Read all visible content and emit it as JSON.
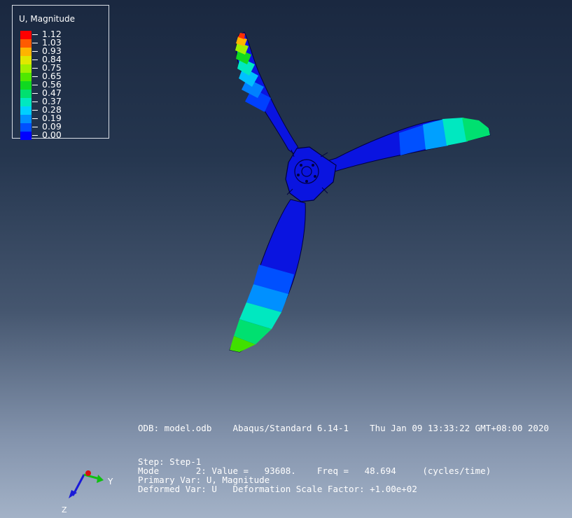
{
  "legend": {
    "title": "U, Magnitude",
    "entries": [
      {
        "value": "1.12",
        "color": "#ff0000"
      },
      {
        "value": "1.03",
        "color": "#ff5a00"
      },
      {
        "value": "0.93",
        "color": "#ffb400"
      },
      {
        "value": "0.84",
        "color": "#e0e800"
      },
      {
        "value": "0.75",
        "color": "#a0f000"
      },
      {
        "value": "0.65",
        "color": "#50e800"
      },
      {
        "value": "0.56",
        "color": "#10d820"
      },
      {
        "value": "0.47",
        "color": "#00e070"
      },
      {
        "value": "0.37",
        "color": "#00e8c0"
      },
      {
        "value": "0.28",
        "color": "#00d0ff"
      },
      {
        "value": "0.19",
        "color": "#0090ff"
      },
      {
        "value": "0.09",
        "color": "#0050ff"
      },
      {
        "value": "0.00",
        "color": "#0000ff"
      }
    ]
  },
  "info": {
    "odb_line": "ODB: model.odb    Abaqus/Standard 6.14-1    Thu Jan 09 13:33:22 GMT+08:00 2020",
    "step_line": "Step: Step-1",
    "mode_line": "Mode       2: Value =   93608.    Freq =   48.694     (cycles/time)",
    "primary_line": "Primary Var: U, Magnitude",
    "deformed_line": "Deformed Var: U   Deformation Scale Factor: +1.00e+02"
  },
  "triad": {
    "y_label": "Y",
    "z_label": "Z"
  },
  "colors": {
    "mesh_base": "#0a14e0",
    "edge": "#000040"
  }
}
